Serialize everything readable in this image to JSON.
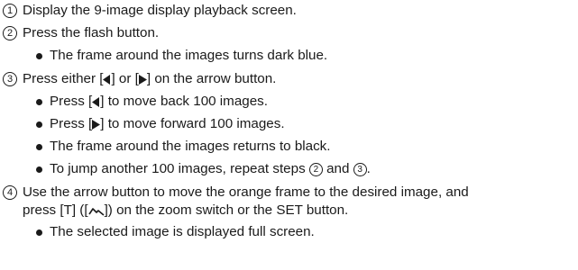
{
  "steps": [
    {
      "number": "1",
      "text": "Display the 9-image display playback screen."
    },
    {
      "number": "2",
      "text": "Press the flash button.",
      "bullets": [
        "The frame around the images turns dark blue."
      ]
    },
    {
      "number": "3",
      "text_pre": "Press either [",
      "text_mid": "] or [",
      "text_post": "] on the arrow button.",
      "bullets": [
        {
          "pre": "Press [",
          "post": "] to move back 100 images."
        },
        {
          "pre": "Press [",
          "post": "] to move forward 100 images."
        },
        "The frame around the images returns to black.",
        {
          "pre": "To jump another 100 images, repeat steps ",
          "ref1": "2",
          "mid": " and ",
          "ref2": "3",
          "post": "."
        }
      ]
    },
    {
      "number": "4",
      "line1": "Use the arrow button to move the orange frame to the desired image, and",
      "line2_pre": "press [T] ([",
      "line2_post": "]) on the zoom switch or the SET button.",
      "bullets": [
        "The selected image is displayed full screen."
      ]
    }
  ],
  "icons": {
    "left_arrow": "left-triangle-icon",
    "right_arrow": "right-triangle-icon",
    "zoom_tele": "zoom-tele-icon"
  }
}
